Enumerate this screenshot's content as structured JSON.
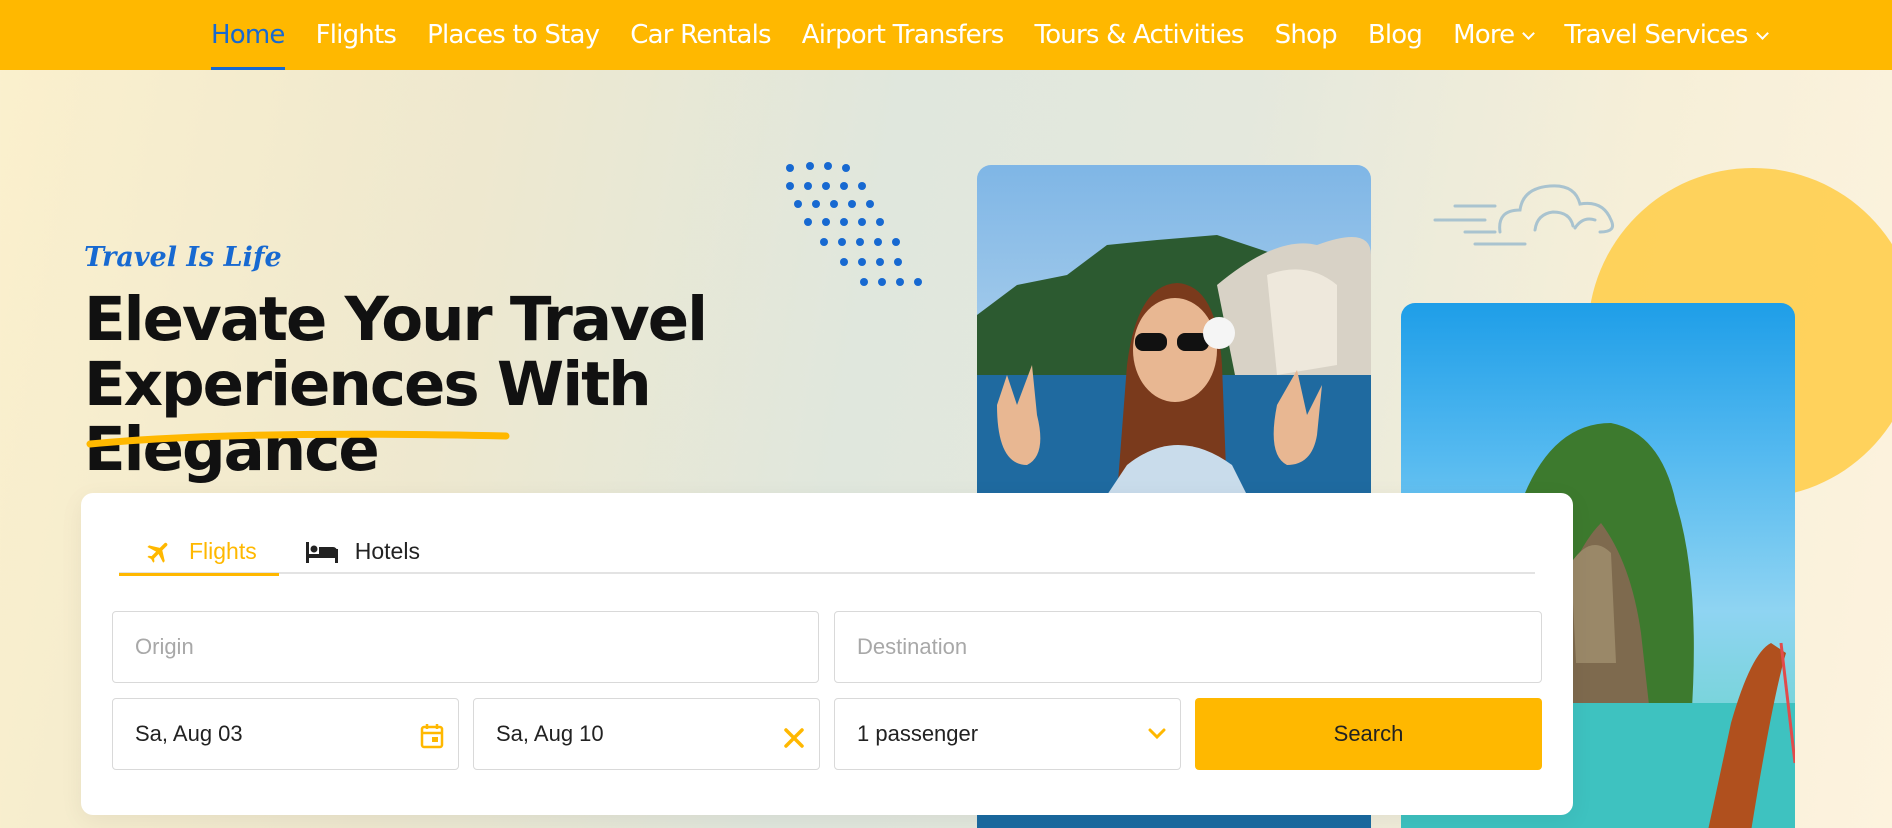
{
  "nav": {
    "items": [
      {
        "label": "Home",
        "active": true
      },
      {
        "label": "Flights"
      },
      {
        "label": "Places to Stay"
      },
      {
        "label": "Car Rentals"
      },
      {
        "label": "Airport Transfers"
      },
      {
        "label": "Tours & Activities"
      },
      {
        "label": "Shop"
      },
      {
        "label": "Blog"
      },
      {
        "label": "More",
        "dropdown": true
      },
      {
        "label": "Travel Services",
        "dropdown": true
      }
    ]
  },
  "hero": {
    "tagline": "Travel Is Life",
    "headline_line1": "Elevate Your Travel",
    "headline_line2": "Experiences With Elegance"
  },
  "search": {
    "tabs": [
      {
        "label": "Flights",
        "icon": "airplane-icon",
        "active": true
      },
      {
        "label": "Hotels",
        "icon": "bed-icon"
      }
    ],
    "origin_placeholder": "Origin",
    "destination_placeholder": "Destination",
    "depart_date": "Sa, Aug 03",
    "return_date": "Sa, Aug 10",
    "passengers": "1 passenger",
    "search_label": "Search"
  },
  "colors": {
    "brand": "#ffb800",
    "accent": "#1769d1"
  }
}
